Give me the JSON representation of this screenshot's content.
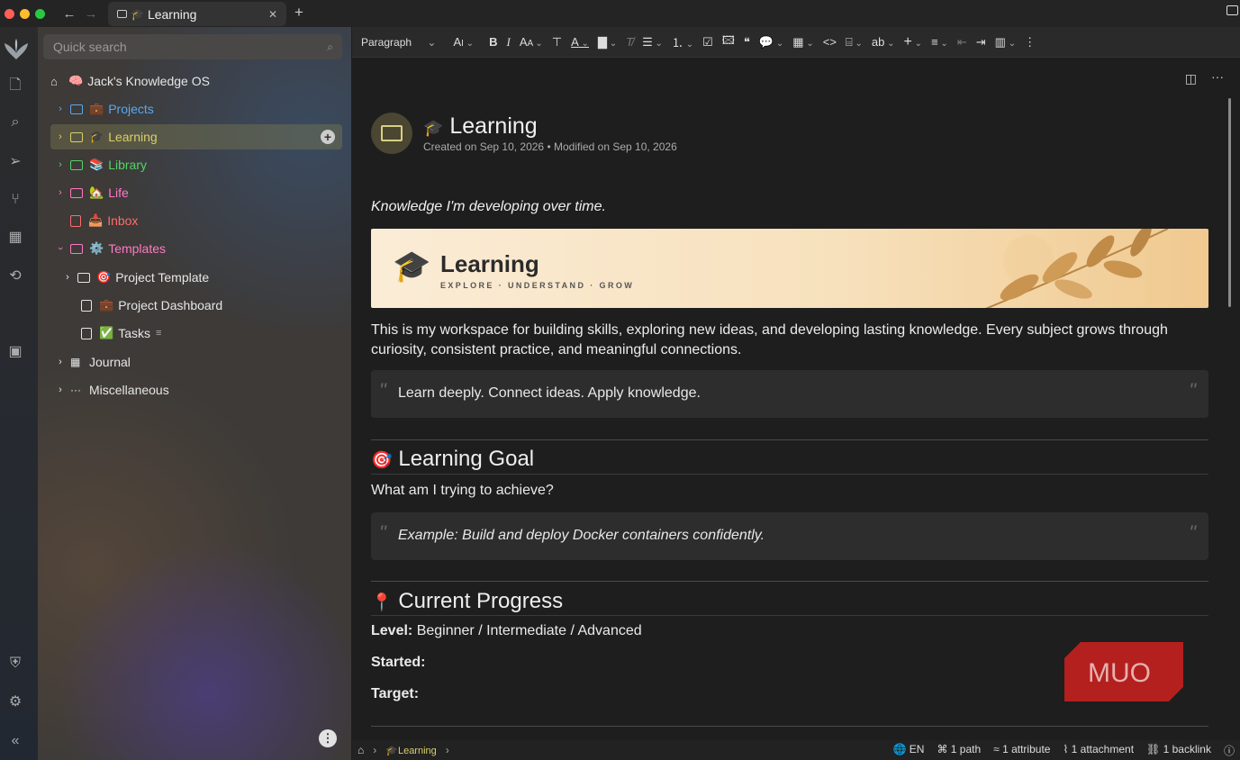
{
  "tab": {
    "title": "Learning",
    "emoji": "🎓"
  },
  "search": {
    "placeholder": "Quick search"
  },
  "colors": {
    "accent": "#d9cf6a",
    "blue": "#5aa7ef",
    "green": "#56d364",
    "pink": "#ff79c6",
    "red": "#ff6b6b"
  },
  "tree": {
    "root": "Jack's Knowledge OS",
    "root_emoji": "🧠",
    "items": [
      {
        "label": "Projects",
        "emoji": "💼"
      },
      {
        "label": "Learning",
        "emoji": "🎓"
      },
      {
        "label": "Library",
        "emoji": "📚"
      },
      {
        "label": "Life",
        "emoji": "🏡"
      },
      {
        "label": "Inbox",
        "emoji": "📥"
      },
      {
        "label": "Templates",
        "emoji": "⚙️"
      },
      {
        "label": "Project Template",
        "emoji": "🎯"
      },
      {
        "label": "Project Dashboard",
        "emoji": "💼"
      },
      {
        "label": "Tasks",
        "emoji": "✅"
      },
      {
        "label": "Journal",
        "emoji": ""
      },
      {
        "label": "Miscellaneous",
        "emoji": ""
      }
    ]
  },
  "toolbar": {
    "paragraph": "Paragraph"
  },
  "note": {
    "title": "Learning",
    "title_emoji": "🎓",
    "meta": "Created on Sep 10, 2026 • Modified on Sep 10, 2026",
    "intro": "Knowledge I'm developing over time.",
    "banner_title": "Learning",
    "banner_sub": "EXPLORE · UNDERSTAND · GROW",
    "paragraph": "This is my workspace for building skills, exploring new ideas, and developing lasting knowledge. Every subject grows through curiosity, consistent practice, and meaningful connections.",
    "quote1": "Learn deeply. Connect ideas. Apply knowledge.",
    "goal_heading": "Learning Goal",
    "goal_emoji": "🎯",
    "goal_question": "What am I trying to achieve?",
    "goal_quote": "Example: Build and deploy Docker containers confidently.",
    "progress_heading": "Current Progress",
    "progress_emoji": "📍",
    "level_label": "Level:",
    "level_value": " Beginner / Intermediate / Advanced",
    "started_label": "Started:",
    "target_label": "Target:",
    "watermark": "MUO"
  },
  "status": {
    "crumb": "Learning",
    "lang": "EN",
    "paths": "1 path",
    "attributes": "1 attribute",
    "attachments": "1 attachment",
    "backlinks": "1 backlink"
  }
}
